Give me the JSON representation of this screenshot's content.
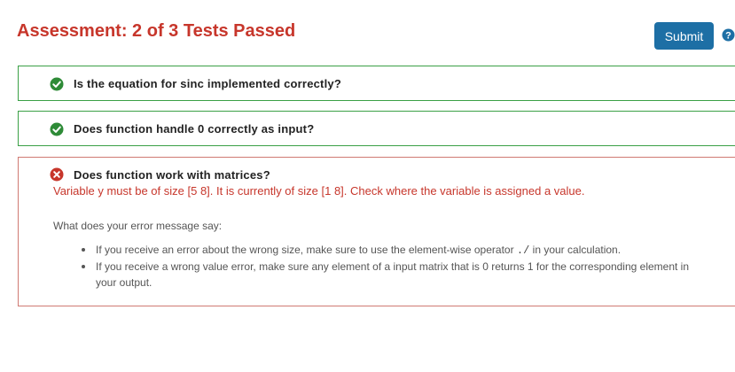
{
  "header": {
    "title": "Assessment: 2 of 3 Tests Passed",
    "submit_label": "Submit",
    "help_icon": "question-circle-icon"
  },
  "colors": {
    "title_red": "#c7362b",
    "submit_blue": "#1d6fa5",
    "pass_green": "#2e8b37",
    "fail_red": "#c7362b"
  },
  "tests": [
    {
      "status": "passed",
      "icon": "check-circle-icon",
      "question": "Is the equation for sinc implemented correctly?"
    },
    {
      "status": "passed",
      "icon": "check-circle-icon",
      "question": "Does function handle 0 correctly as input?"
    },
    {
      "status": "failed",
      "icon": "x-circle-icon",
      "question": "Does function work with matrices?",
      "error_message": "Variable y must be of size [5 8]. It is currently of size [1 8]. Check where the variable is assigned a value.",
      "feedback_heading": "What does your error message say:",
      "feedback_items": [
        {
          "before": "If you receive an error about the wrong size, make sure to use the element-wise operator ",
          "code": "./",
          "after": " in your calculation."
        },
        {
          "text": "If you receive a wrong value error, make sure any element of a input matrix that is 0 returns 1 for the corresponding element in your output."
        }
      ]
    }
  ]
}
